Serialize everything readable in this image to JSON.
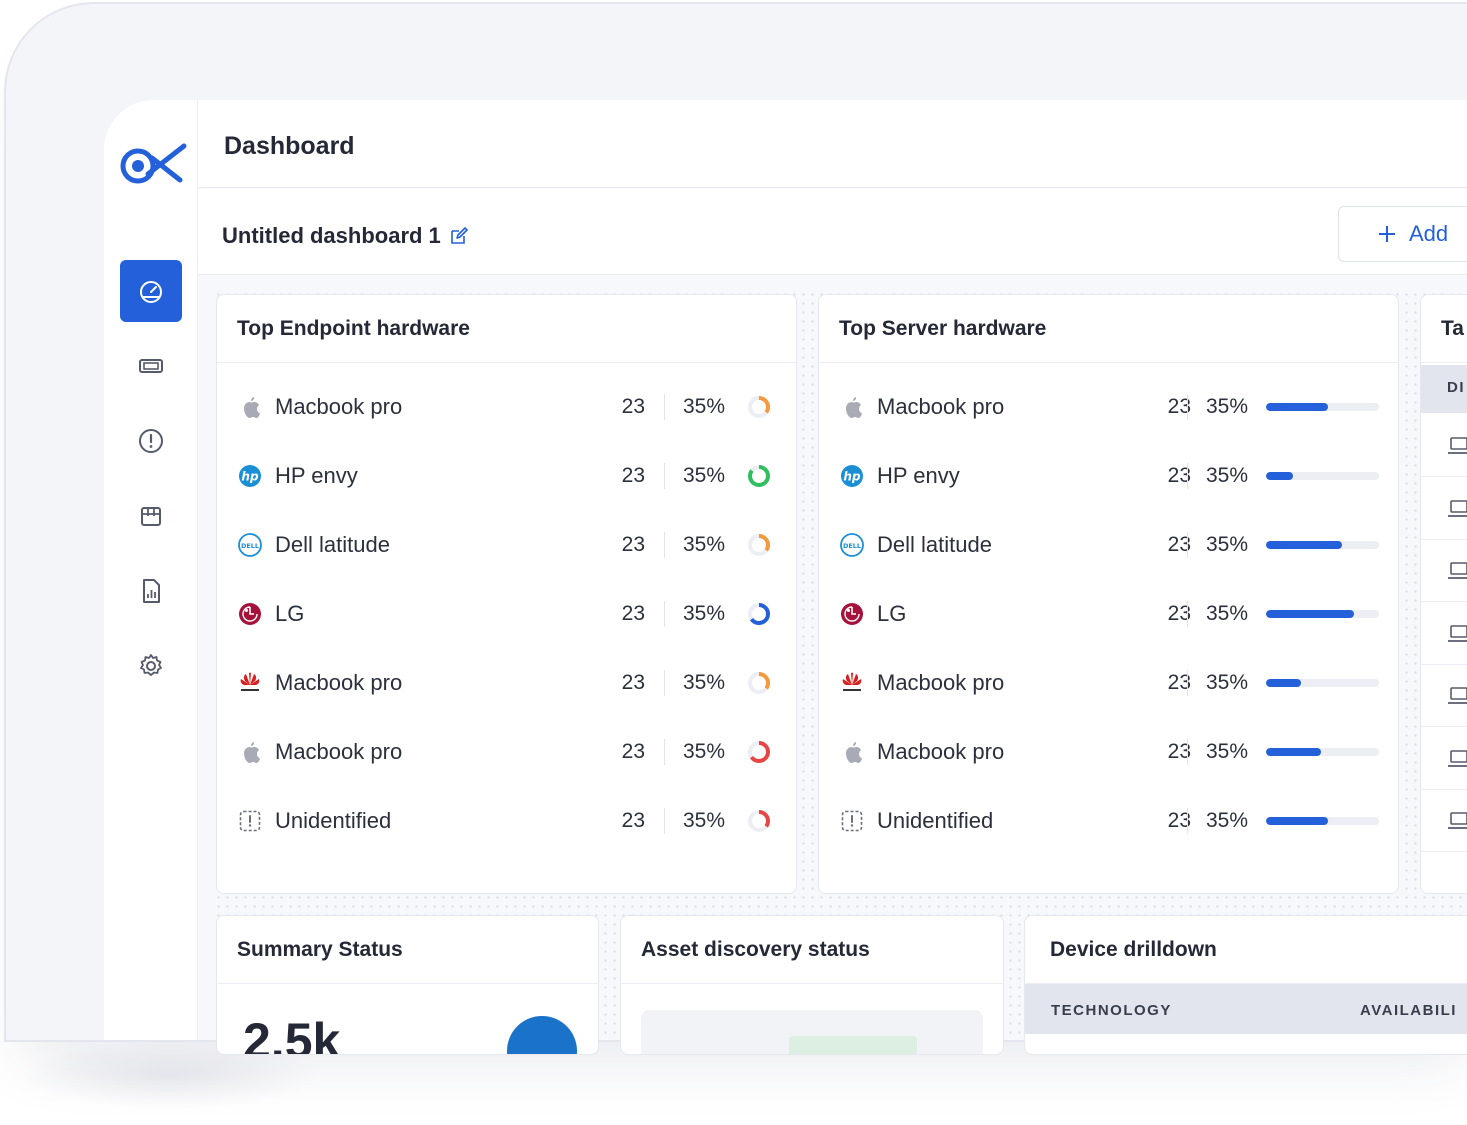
{
  "header": {
    "title": "Dashboard"
  },
  "dashboard": {
    "name": "Untitled dashboard 1",
    "add_label": "Add"
  },
  "sidebar": {
    "items": [
      {
        "name": "dashboard",
        "icon": "gauge-icon",
        "active": true
      },
      {
        "name": "tickets",
        "icon": "ticket-icon",
        "active": false
      },
      {
        "name": "alerts",
        "icon": "alert-circle-icon",
        "active": false
      },
      {
        "name": "assets",
        "icon": "package-icon",
        "active": false
      },
      {
        "name": "reports",
        "icon": "report-icon",
        "active": false
      },
      {
        "name": "settings",
        "icon": "gear-icon",
        "active": false
      }
    ]
  },
  "endpoint_card": {
    "title": "Top Endpoint hardware",
    "rows": [
      {
        "brand_icon": "apple-icon",
        "name": "Macbook pro",
        "count": "23",
        "percent": "35%",
        "ring_color": "#f59a3c",
        "ring_fraction": 0.35
      },
      {
        "brand_icon": "hp-icon",
        "name": "HP envy",
        "count": "23",
        "percent": "35%",
        "ring_color": "#2fbf5f",
        "ring_fraction": 0.85
      },
      {
        "brand_icon": "dell-icon",
        "name": "Dell latitude",
        "count": "23",
        "percent": "35%",
        "ring_color": "#f59a3c",
        "ring_fraction": 0.35
      },
      {
        "brand_icon": "lg-icon",
        "name": "LG",
        "count": "23",
        "percent": "35%",
        "ring_color": "#2460d9",
        "ring_fraction": 0.65
      },
      {
        "brand_icon": "huawei-icon",
        "name": "Macbook pro",
        "count": "23",
        "percent": "35%",
        "ring_color": "#f59a3c",
        "ring_fraction": 0.35
      },
      {
        "brand_icon": "apple-icon",
        "name": "Macbook pro",
        "count": "23",
        "percent": "35%",
        "ring_color": "#e84545",
        "ring_fraction": 0.65
      },
      {
        "brand_icon": "unidentified-icon",
        "name": "Unidentified",
        "count": "23",
        "percent": "35%",
        "ring_color": "#e84545",
        "ring_fraction": 0.35
      }
    ]
  },
  "server_card": {
    "title": "Top Server hardware",
    "rows": [
      {
        "brand_icon": "apple-icon",
        "name": "Macbook pro",
        "count": "23",
        "percent": "35%",
        "bar_fraction": 0.55
      },
      {
        "brand_icon": "hp-icon",
        "name": "HP envy",
        "count": "23",
        "percent": "35%",
        "bar_fraction": 0.24
      },
      {
        "brand_icon": "dell-icon",
        "name": "Dell latitude",
        "count": "23",
        "percent": "35%",
        "bar_fraction": 0.67
      },
      {
        "brand_icon": "lg-icon",
        "name": "LG",
        "count": "23",
        "percent": "35%",
        "bar_fraction": 0.78
      },
      {
        "brand_icon": "huawei-icon",
        "name": "Macbook pro",
        "count": "23",
        "percent": "35%",
        "bar_fraction": 0.31
      },
      {
        "brand_icon": "apple-icon",
        "name": "Macbook pro",
        "count": "23",
        "percent": "35%",
        "bar_fraction": 0.49
      },
      {
        "brand_icon": "unidentified-icon",
        "name": "Unidentified",
        "count": "23",
        "percent": "35%",
        "bar_fraction": 0.55
      }
    ]
  },
  "partial_card": {
    "title": "Ta",
    "header": "DI",
    "row_icon": "laptop-icon",
    "row_count": 7
  },
  "summary_card": {
    "title": "Summary Status",
    "value": "2.5k"
  },
  "asset_card": {
    "title": "Asset discovery status"
  },
  "drilldown_card": {
    "title": "Device drilldown",
    "col_technology": "TECHNOLOGY",
    "col_availability": "AVAILABILI"
  },
  "colors": {
    "accent": "#2460d9",
    "orange": "#f59a3c",
    "green": "#2fbf5f",
    "red": "#e84545"
  }
}
